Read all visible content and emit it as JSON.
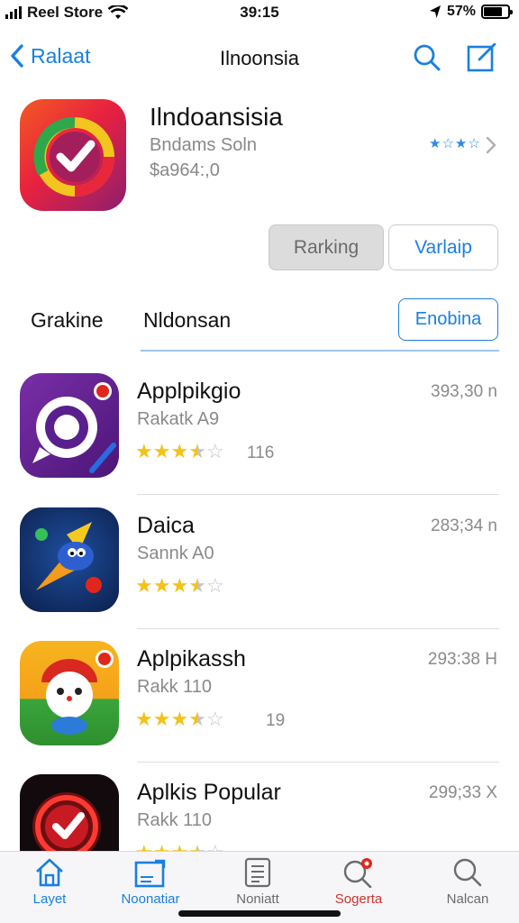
{
  "status_bar": {
    "carrier": "Reel Store",
    "time": "39:15",
    "battery": "57%"
  },
  "nav": {
    "back_label": "Ralaat",
    "title": "Ilnoonsia"
  },
  "featured": {
    "name": "Ilndoansisia",
    "developer": "Bndams Soln",
    "price": "$a964:,0",
    "stars_text": "★☆★☆"
  },
  "actions": {
    "ranking_label": "Rarking",
    "variant_label": "Varlaip"
  },
  "segments": {
    "left_label": "Grakine",
    "middle_label": "Nldonsan",
    "button_label": "Enobina"
  },
  "apps": [
    {
      "name": "Applpikgio",
      "category": "Rakatk A9",
      "rating": 3.5,
      "rating_count": "116",
      "size": "393,30 n"
    },
    {
      "name": "Daica",
      "category": "Sannk A0",
      "rating": 3.5,
      "rating_count": "",
      "size": "283;34 n"
    },
    {
      "name": "Aplpikassh",
      "category": "Rakk 110",
      "rating": 3.5,
      "rating_count": "19",
      "size": "293:38 H"
    },
    {
      "name": "Aplkis Popular",
      "category": "Rakk 110",
      "rating": 3.5,
      "rating_count": "",
      "size": "299;33 X"
    }
  ],
  "tabs": [
    {
      "label": "Layet",
      "icon": "house-icon",
      "color": "#1a7fe0"
    },
    {
      "label": "Noonatiar",
      "icon": "news-icon",
      "color": "#1a7fe0"
    },
    {
      "label": "Noniatt",
      "icon": "list-icon",
      "color": "#6b6b6b"
    },
    {
      "label": "Sogerta",
      "icon": "search-badge-icon",
      "color": "#d0312d"
    },
    {
      "label": "Nalcan",
      "icon": "search-icon",
      "color": "#6b6b6b"
    }
  ],
  "colors": {
    "accent": "#1a7fe0",
    "star": "#f3c21b",
    "badge": "#e0271b"
  }
}
